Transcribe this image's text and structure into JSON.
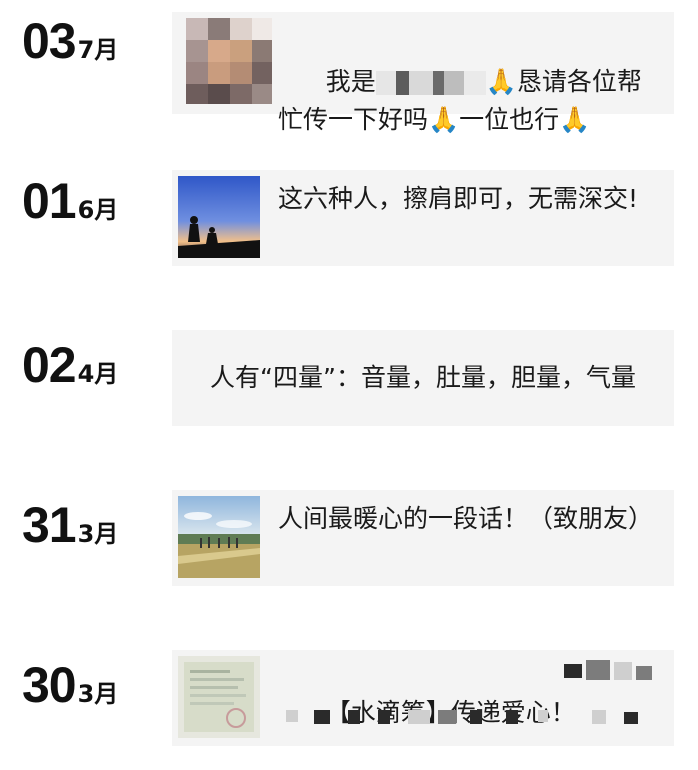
{
  "posts": [
    {
      "day": "03",
      "month": "7月",
      "text": "我是",
      "text_tail": "🙏恳请各位帮忙传一下好吗🙏一位也行🙏",
      "thumb_icon": "blurred-portrait-photo"
    },
    {
      "day": "01",
      "month": "6月",
      "text": "这六种人，擦肩即可，无需深交!",
      "thumb_icon": "sunset-silhouette-photo"
    },
    {
      "day": "02",
      "month": "4月",
      "text": "人有“四量”：音量，肚量，胆量，气量",
      "thumb_icon": ""
    },
    {
      "day": "31",
      "month": "3月",
      "text": "人间最暖心的一段话！（致朋友）",
      "thumb_icon": "field-landscape-photo"
    },
    {
      "day": "30",
      "month": "3月",
      "text": "【水滴筹】传递爱心！",
      "thumb_icon": "document-photo"
    }
  ],
  "colors": {
    "card_bg": "#f4f4f4",
    "date_text": "#111111",
    "body_text": "#1a1a1a"
  }
}
